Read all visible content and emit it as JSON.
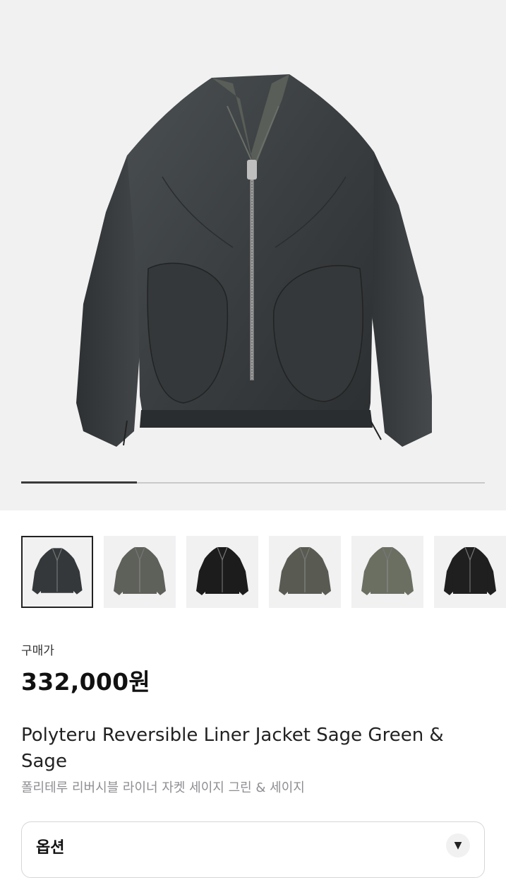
{
  "gallery": {
    "progress": 0.25,
    "thumbnails": [
      {
        "name": "thumb-1",
        "body": "#34383a",
        "selected": true
      },
      {
        "name": "thumb-2",
        "body": "#5e605a",
        "selected": false
      },
      {
        "name": "thumb-3",
        "body": "#1c1c1c",
        "selected": false
      },
      {
        "name": "thumb-4",
        "body": "#595b52",
        "selected": false
      },
      {
        "name": "thumb-5",
        "body": "#6b6f62",
        "selected": false
      },
      {
        "name": "thumb-6",
        "body": "#1f1f20",
        "selected": false
      }
    ]
  },
  "product": {
    "price_label": "구매가",
    "price": "332,000원",
    "title_en": "Polyteru Reversible Liner Jacket Sage Green & Sage",
    "title_ko": "폴리테루 리버시블 라이너 자켓 세이지 그린 & 세이지"
  },
  "option": {
    "label": "옵션",
    "chevron": "▼"
  },
  "colors": {
    "background": "#f1f1f2",
    "jacket": "#3b3f41",
    "accent": "#111111"
  }
}
